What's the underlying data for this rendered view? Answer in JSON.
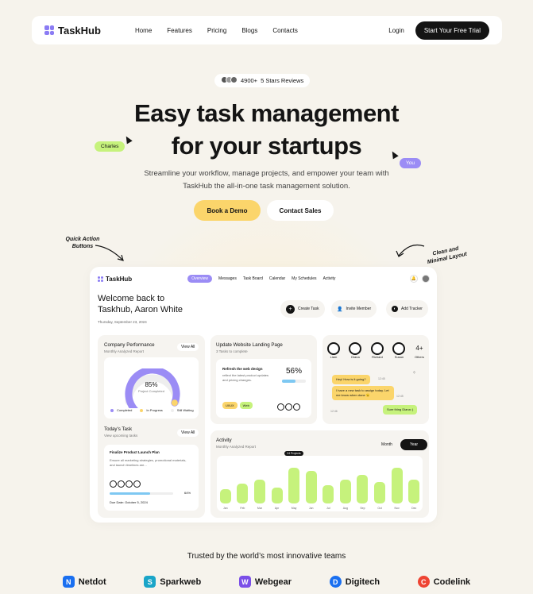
{
  "nav": {
    "logo": "TaskHub",
    "links": [
      "Home",
      "Features",
      "Pricing",
      "Blogs",
      "Contacts"
    ],
    "login": "Login",
    "cta": "Start Your Free Trial"
  },
  "hero": {
    "reviews_count": "4900+",
    "reviews_label": "5 Stars Reviews",
    "title_line1": "Easy task management",
    "title_line2": "for your startups",
    "subtitle_line1": "Streamline your workflow, manage projects, and empower your team with",
    "subtitle_line2": "TaskHub the all-in-one task management solution.",
    "tag_left": "Charles",
    "tag_right": "You",
    "btn_demo": "Book a Demo",
    "btn_sales": "Contact Sales",
    "note_left": "Quick Action\nButtons",
    "note_right": "Clean and\nMinimal Layout"
  },
  "dashboard": {
    "logo": "TaskHub",
    "tabs": [
      "Overview",
      "Messages",
      "Task Board",
      "Calendar",
      "My Schedules",
      "Activity"
    ],
    "welcome_line1": "Welcome back to",
    "welcome_line2": "Taskhub, Aaron White",
    "date": "Thursday, September 23, 2024",
    "actions": [
      "Create Task",
      "Invite Member",
      "Add Tracker"
    ],
    "performance": {
      "title": "Company Performance",
      "sub": "Monthly Analyzed Report",
      "view": "View All",
      "value": "85%",
      "value_label": "Project Completed",
      "legend": [
        "Completed",
        "In Progress",
        "Still Waiting"
      ],
      "percent": 0.85
    },
    "update": {
      "title": "Update Website Landing Page",
      "sub": "3 Tasks to complete",
      "item_title": "Refresh the web design",
      "item_desc": "reflect the latest product updates and pricing changes.",
      "percent": "56%",
      "progress": 0.56,
      "tags": [
        "UI/UX",
        "Web"
      ]
    },
    "team": {
      "members": [
        "Liam",
        "Diana",
        "Richard",
        "Susan"
      ],
      "others_count": "4+",
      "others_label": "Others"
    },
    "chat": [
      {
        "text": "Hey! How is it going?",
        "time": "12:45"
      },
      {
        "text": "I have a new task to assign today. Let me know when done 😉",
        "time": "12:45"
      },
      {
        "text": "Sure thing Diana :)",
        "time": "12:46"
      }
    ],
    "today": {
      "title": "Today's Task",
      "sub": "View upcoming tasks",
      "view": "View All",
      "task_title": "Finalize Product Launch Plan",
      "task_desc": "Ensure all marketing strategies, promotional materials, and launch timelines are...",
      "progress_label": "64%",
      "progress": 0.64,
      "due": "Due Date: October 5, 2024"
    },
    "activity": {
      "title": "Activity",
      "sub": "Monthly Analyzed Report",
      "toggle": [
        "Month",
        "Year"
      ],
      "tooltip": "24 Projects",
      "months": [
        "Jan",
        "Feb",
        "Mar",
        "Apr",
        "May",
        "Jun",
        "Jul",
        "Aug",
        "Sep",
        "Oct",
        "Nov",
        "Dec"
      ],
      "values": [
        4,
        5.5,
        6.5,
        4.5,
        10,
        9,
        5,
        6.5,
        8,
        6,
        10,
        6.5
      ]
    }
  },
  "trusted": "Trusted by the world’s most innovative teams",
  "brands": [
    {
      "name": "Netdot",
      "color": "#1a6ff0",
      "icon": "N"
    },
    {
      "name": "Sparkweb",
      "color": "#1aa5c8",
      "icon": "S"
    },
    {
      "name": "Webgear",
      "color": "#7b4fe8",
      "icon": "W"
    },
    {
      "name": "Digitech",
      "color": "#1a6ff0",
      "icon": "D"
    },
    {
      "name": "Codelink",
      "color": "#ee4433",
      "icon": "C"
    }
  ]
}
